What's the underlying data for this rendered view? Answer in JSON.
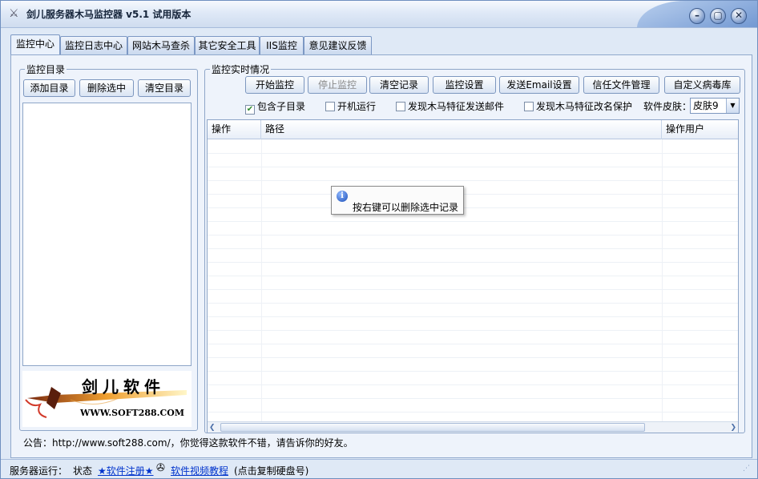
{
  "window": {
    "title": "剑儿服务器木马监控器 v5.1  试用版本",
    "controls": {
      "minimize": "–",
      "restore": "▢",
      "close": "✕"
    }
  },
  "tabs": [
    "监控中心",
    "监控日志中心",
    "网站木马查杀",
    "其它安全工具",
    "IIS监控",
    "意见建议反馈"
  ],
  "left_group": {
    "legend": "监控目录",
    "buttons": [
      "添加目录",
      "删除选中",
      "清空目录"
    ],
    "logo": {
      "text": "剑儿软件",
      "url": "WWW.SOFT288.COM"
    }
  },
  "right_group": {
    "legend": "监控实时情况",
    "buttons": [
      {
        "label": "开始监控",
        "enabled": true
      },
      {
        "label": "停止监控",
        "enabled": false
      },
      {
        "label": "清空记录",
        "enabled": true
      },
      {
        "label": "监控设置",
        "enabled": true
      },
      {
        "label": "发送Email设置",
        "enabled": true
      },
      {
        "label": "信任文件管理",
        "enabled": true
      },
      {
        "label": "自定义病毒库",
        "enabled": true
      }
    ],
    "options": [
      {
        "label": "包含子目录",
        "checked": true
      },
      {
        "label": "开机运行",
        "checked": false
      },
      {
        "label": "发现木马特征发送邮件",
        "checked": false
      },
      {
        "label": "发现木马特征改名保护",
        "checked": false
      }
    ],
    "skin": {
      "label": "软件皮肤：",
      "value": "皮肤9"
    },
    "grid": {
      "columns": [
        "操作",
        "路径",
        "操作用户"
      ]
    },
    "tooltip": "按右键可以删除选中记录"
  },
  "notice": "公告：http://www.soft288.com/，你觉得这款软件不错，请告诉你的好友。",
  "statusbar": {
    "server": "服务器运行：",
    "state": "状态",
    "register": "★软件注册★",
    "video": "软件视频教程",
    "copy_hint": "(点击复制硬盘号)"
  },
  "colors": {
    "frame": "#dfe9f6",
    "panel": "#eef3fb",
    "link": "#0033cc",
    "checked": "#2f8a2f"
  }
}
